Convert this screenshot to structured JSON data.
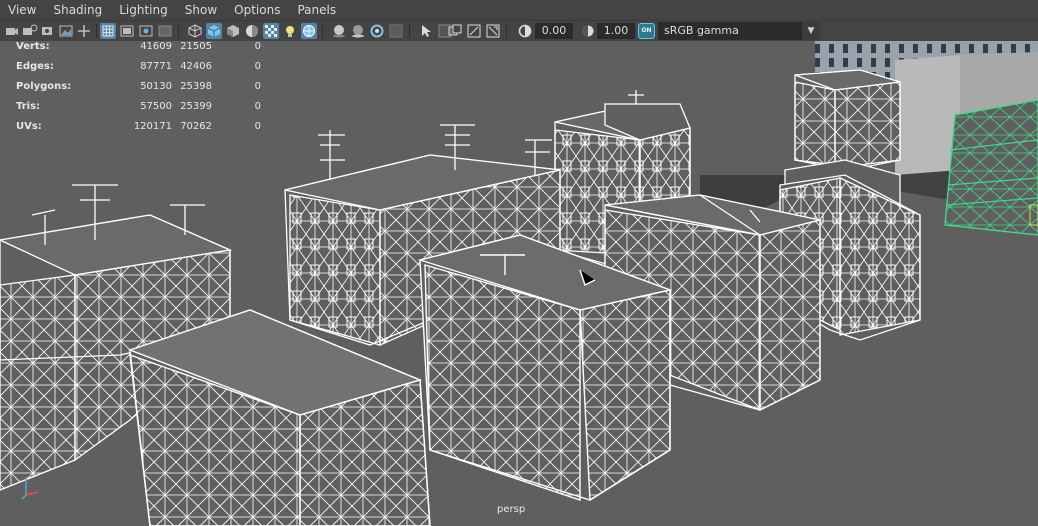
{
  "menu": {
    "items": [
      "View",
      "Shading",
      "Lighting",
      "Show",
      "Options",
      "Panels"
    ]
  },
  "toolbar": {
    "exposure_value": "0.00",
    "gamma_value": "1.00",
    "color_management_badge": "ON",
    "color_space": "sRGB gamma",
    "icons": [
      "select-camera-icon",
      "camera-attributes-icon",
      "bookmark-icon",
      "image-plane-icon",
      "two-d-pan-zoom-icon",
      "grease-pencil-icon",
      "grid-icon",
      "film-gate-icon",
      "resolution-gate-icon",
      "gate-mask-icon",
      "field-chart-icon",
      "wireframe-icon",
      "smooth-shade-icon",
      "flat-shade-icon",
      "bounding-box-icon",
      "textured-icon",
      "use-lights-icon",
      "wireframe-on-shaded-icon",
      "xray-icon",
      "xray-joints-icon",
      "xray-active-icon",
      "isolate-select-icon",
      "ambient-occlusion-icon",
      "motion-blur-icon",
      "anti-aliasing-icon",
      "depth-of-field-icon",
      "exposure-icon",
      "gamma-icon",
      "color-management-icon"
    ]
  },
  "hud": {
    "rows": [
      {
        "label": "Verts:",
        "c1": "41609",
        "c2": "21505",
        "c3": "0"
      },
      {
        "label": "Edges:",
        "c1": "87771",
        "c2": "42406",
        "c3": "0"
      },
      {
        "label": "Polygons:",
        "c1": "50130",
        "c2": "25398",
        "c3": "0"
      },
      {
        "label": "Tris:",
        "c1": "57500",
        "c2": "25399",
        "c3": "0"
      },
      {
        "label": "UVs:",
        "c1": "120171",
        "c2": "70262",
        "c3": "0"
      }
    ]
  },
  "viewport": {
    "camera_label": "persp",
    "wire_color": "#ffffff",
    "selected_wire_color": "#3ed98a",
    "background_color": "#5f5f5f"
  },
  "colors": {
    "ui_bg": "#444444",
    "accent": "#5285a6"
  }
}
